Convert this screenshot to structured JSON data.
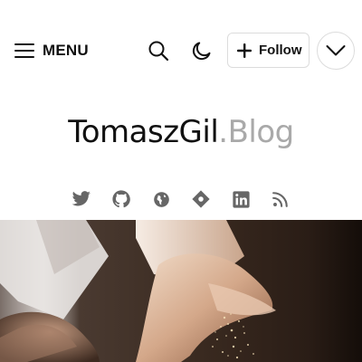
{
  "header": {
    "menu_label": "MENU",
    "follow_label": "Follow",
    "icons": {
      "menu": "hamburger-icon",
      "search": "search-icon",
      "theme": "moon-icon",
      "follow": "plus-icon",
      "expand": "chevron-down-icon"
    }
  },
  "logo": {
    "main": "TomaszGil",
    "sub": ".Blog"
  },
  "social": [
    {
      "name": "twitter-icon"
    },
    {
      "name": "github-icon"
    },
    {
      "name": "website-globe-icon"
    },
    {
      "name": "tag-icon"
    },
    {
      "name": "linkedin-icon"
    },
    {
      "name": "rss-icon"
    }
  ],
  "colors": {
    "text": "#111111",
    "muted_logo": "#a9a9a9",
    "social_icon": "#666666",
    "border": "#dcdcdc"
  }
}
